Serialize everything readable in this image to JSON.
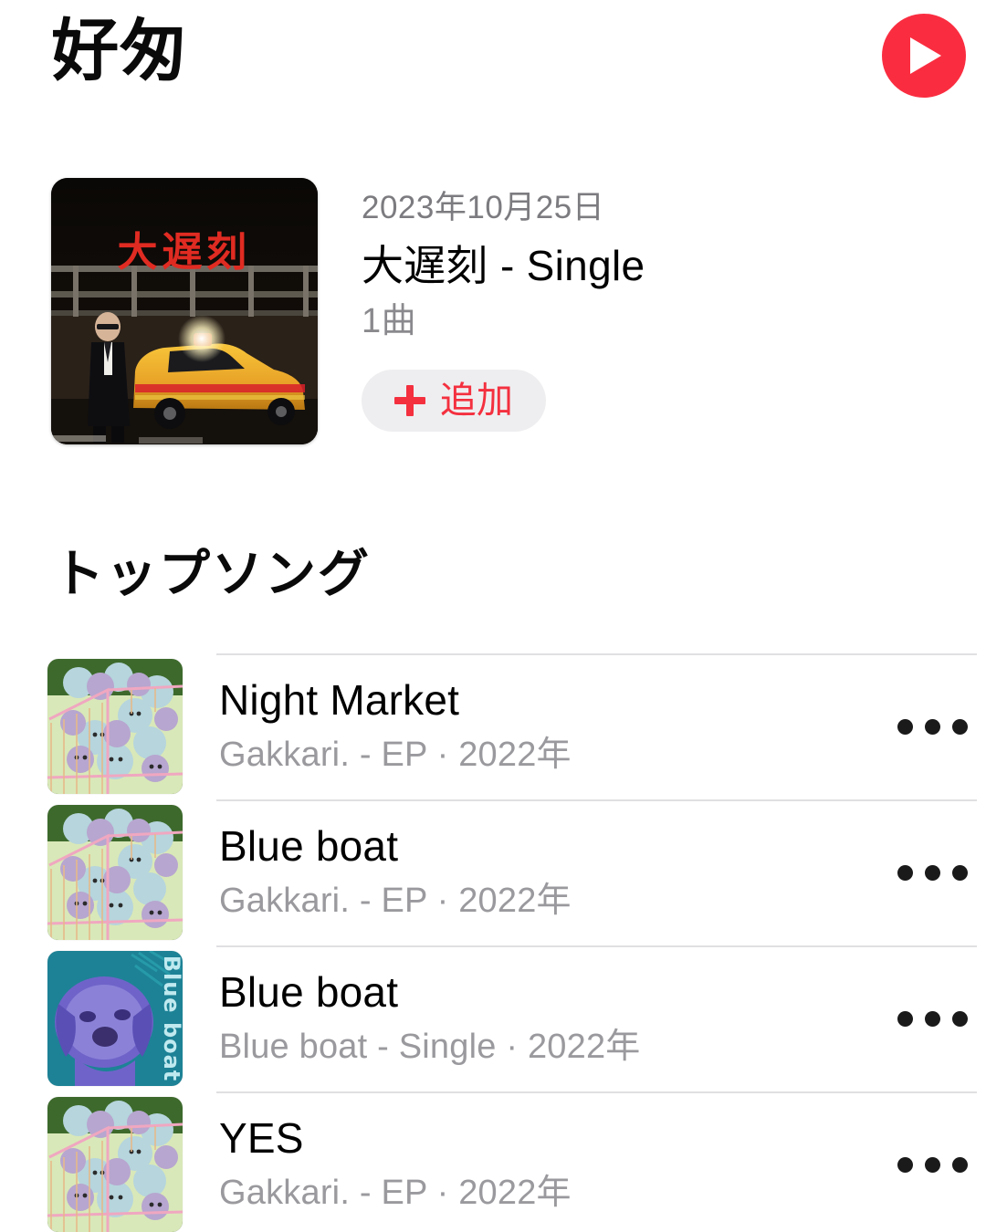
{
  "header": {
    "artist_name": "好匆",
    "play_button_icon": "play-icon",
    "accent_color": "#fa2d40"
  },
  "featured_album": {
    "release_date": "2023年10月25日",
    "title": "大遅刻 - Single",
    "track_count": "1曲",
    "add_button_label": "追加",
    "add_button_icon": "plus-icon",
    "artwork_alt": "大遅刻 - Single artwork: night highway scene with yellow taxi and person in black suit",
    "artwork_text": "大遅刻"
  },
  "top_songs": {
    "section_title": "トップソング",
    "more_icon": "ellipsis-icon",
    "rows": [
      {
        "title": "Night Market",
        "subtitle": "Gakkari. - EP · 2022年",
        "artwork": "gakkari-ep",
        "artwork_alt": "Gakkari. - EP artwork: pastel plush toys in a pink wire basket"
      },
      {
        "title": "Blue boat",
        "subtitle": "Gakkari. - EP · 2022年",
        "artwork": "gakkari-ep",
        "artwork_alt": "Gakkari. - EP artwork: pastel plush toys in a pink wire basket"
      },
      {
        "title": "Blue boat",
        "subtitle": "Blue boat - Single · 2022年",
        "artwork": "blue-boat-single",
        "artwork_alt": "Blue boat - Single artwork: purple dog on teal background",
        "artwork_text": "Blue boat"
      },
      {
        "title": "YES",
        "subtitle": "Gakkari. - EP · 2022年",
        "artwork": "gakkari-ep",
        "artwork_alt": "Gakkari. - EP artwork: pastel plush toys in a pink wire basket"
      }
    ]
  }
}
